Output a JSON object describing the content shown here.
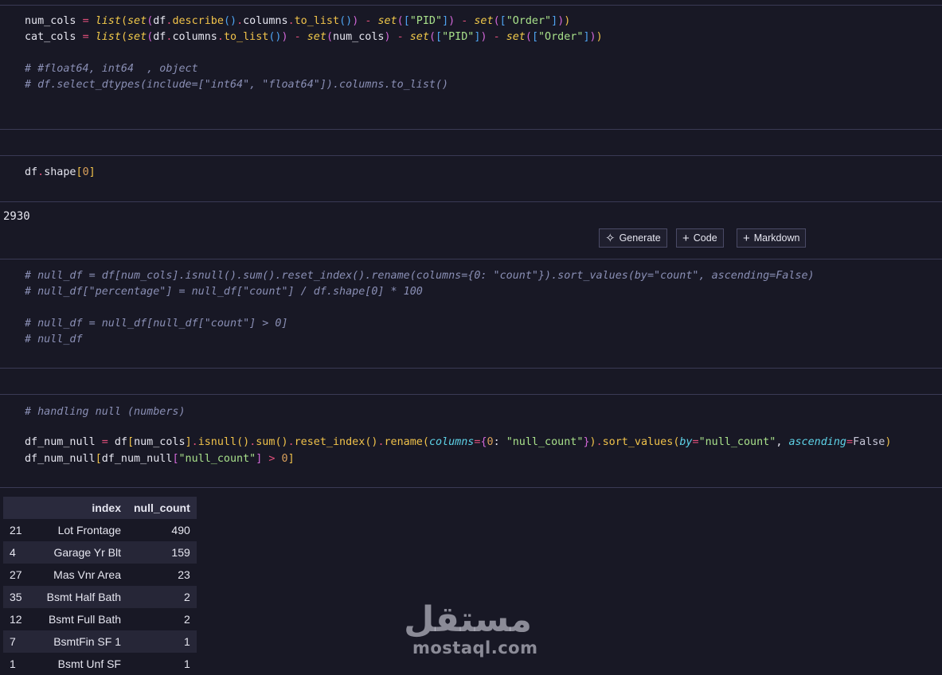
{
  "cells": {
    "cell1": {
      "line1_parts": [
        "num_cols",
        " = ",
        "list",
        "(",
        "set",
        "(",
        "df",
        ".",
        "describe",
        "()",
        ".",
        "columns",
        ".",
        "to_list",
        "()",
        ")",
        " - ",
        "set",
        "(",
        "[",
        "\"PID\"",
        "]",
        ")",
        " - ",
        "set",
        "(",
        "[",
        "\"Order\"",
        "]",
        ")",
        ")"
      ],
      "line1": "num_cols = list(set(df.describe().columns.to_list()) - set([\"PID\"]) - set([\"Order\"]))",
      "line2": "cat_cols = list(set(df.columns.to_list()) - set(num_cols) - set([\"PID\"]) - set([\"Order\"]))",
      "comment1": "# #float64, int64  , object",
      "comment2": "# df.select_dtypes(include=[\"int64\", \"float64\"]).columns.to_list()"
    },
    "cell2": {
      "code": "df.shape[0]",
      "output": "2930"
    },
    "cell3": {
      "comment1": "# null_df = df[num_cols].isnull().sum().reset_index().rename(columns={0: \"count\"}).sort_values(by=\"count\", ascending=False)",
      "comment2": "# null_df[\"percentage\"] = null_df[\"count\"] / df.shape[0] * 100",
      "comment3": "# null_df = null_df[null_df[\"count\"] > 0]",
      "comment4": "# null_df"
    },
    "cell4": {
      "comment": "# handling null (numbers)",
      "line1": "df_num_null = df[num_cols].isnull().sum().reset_index().rename(columns={0: \"null_count\"}).sort_values(by=\"null_count\", ascending=False)",
      "line2": "df_num_null[df_num_null[\"null_count\"] > 0]"
    }
  },
  "toolbar": {
    "generate_label": "Generate",
    "code_label": "Code",
    "markdown_label": "Markdown",
    "generate_icon": "sparkle-icon",
    "code_icon": "plus-icon",
    "markdown_icon": "plus-icon"
  },
  "table": {
    "headers": [
      "",
      "index",
      "null_count"
    ],
    "rows": [
      [
        "21",
        "Lot Frontage",
        "490"
      ],
      [
        "4",
        "Garage Yr Blt",
        "159"
      ],
      [
        "27",
        "Mas Vnr Area",
        "23"
      ],
      [
        "35",
        "Bsmt Half Bath",
        "2"
      ],
      [
        "12",
        "Bsmt Full Bath",
        "2"
      ],
      [
        "7",
        "BsmtFin SF 1",
        "1"
      ],
      [
        "1",
        "Bsmt Unf SF",
        "1"
      ]
    ]
  },
  "watermark": {
    "arabic": "مستقل",
    "latin": "mostaql.com"
  },
  "colors": {
    "background": "#181825",
    "comment": "#8a8fb5",
    "string": "#a8e08a",
    "function": "#f1c94a",
    "operator": "#e04f7a",
    "kwarg": "#5ed3e8"
  }
}
